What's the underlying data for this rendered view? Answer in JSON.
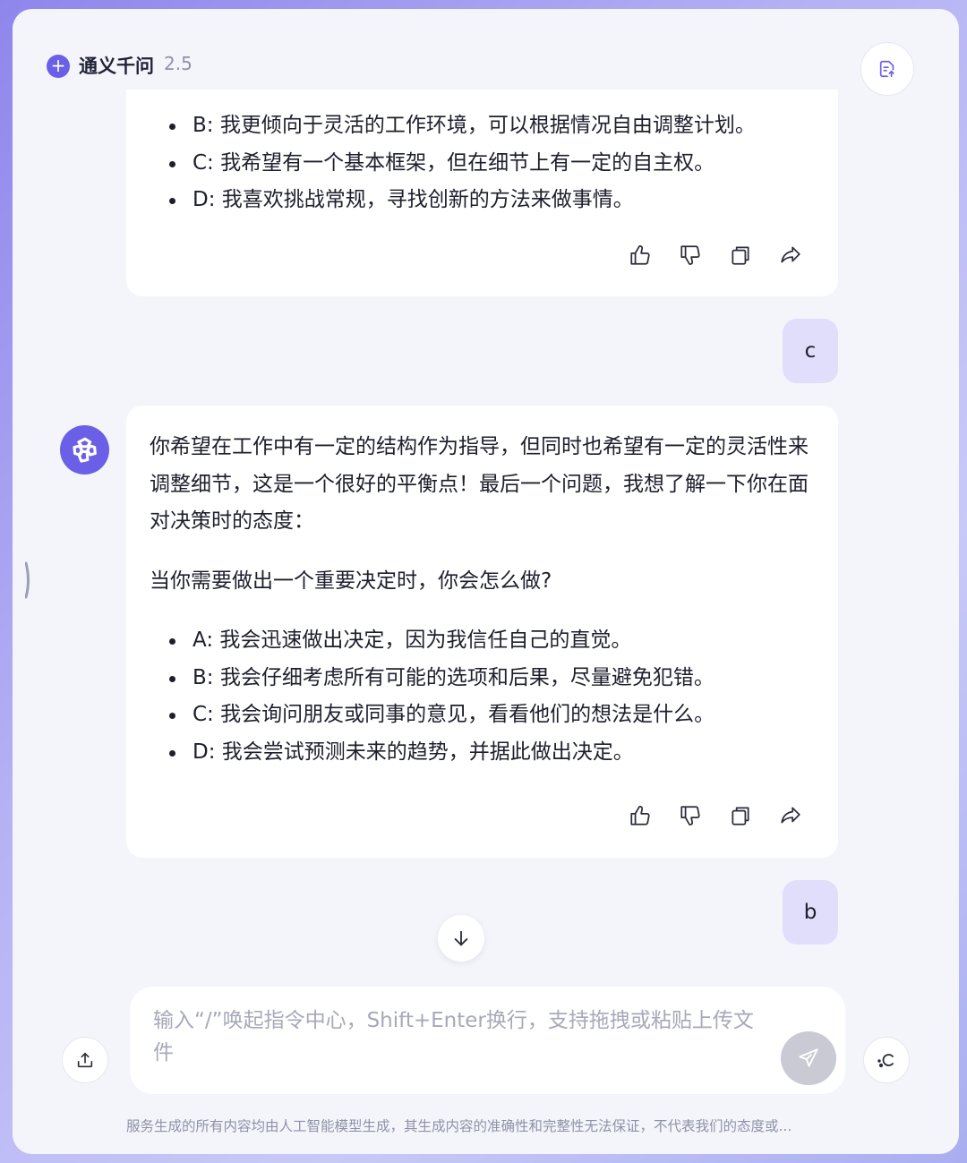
{
  "header": {
    "title": "通义千问",
    "version": "2.5",
    "logo_icon": "plus-icon",
    "action_icon": "document-export-icon"
  },
  "messages": [
    {
      "role": "assistant",
      "options": [
        "B: 我更倾向于灵活的工作环境，可以根据情况自由调整计划。",
        "C: 我希望有一个基本框架，但在细节上有一定的自主权。",
        "D: 我喜欢挑战常规，寻找创新的方法来做事情。"
      ]
    },
    {
      "role": "user",
      "text": "c"
    },
    {
      "role": "assistant",
      "paragraph": "你希望在工作中有一定的结构作为指导，但同时也希望有一定的灵活性来调整细节，这是一个很好的平衡点！最后一个问题，我想了解一下你在面对决策时的态度：",
      "question": "当你需要做出一个重要决定时，你会怎么做?",
      "options": [
        "A: 我会迅速做出决定，因为我信任自己的直觉。",
        "B: 我会仔细考虑所有可能的选项和后果，尽量避免犯错。",
        "C: 我会询问朋友或同事的意见，看看他们的想法是什么。",
        "D: 我会尝试预测未来的趋势，并据此做出决定。"
      ]
    },
    {
      "role": "user",
      "text": "b"
    }
  ],
  "message_actions": [
    "thumbs-up-icon",
    "thumbs-down-icon",
    "copy-icon",
    "share-icon"
  ],
  "composer": {
    "placeholder": "输入“/”唤起指令中心，Shift+Enter换行，支持拖拽或粘贴上传文件",
    "value": ""
  },
  "footer": {
    "disclaimer": "服务生成的所有内容均由人工智能模型生成，其生成内容的准确性和完整性无法保证，不代表我们的态度或..."
  },
  "colors": {
    "accent": "#6a5fe6",
    "user_bubble": "#e1defb",
    "background": "#f4f5fb"
  }
}
